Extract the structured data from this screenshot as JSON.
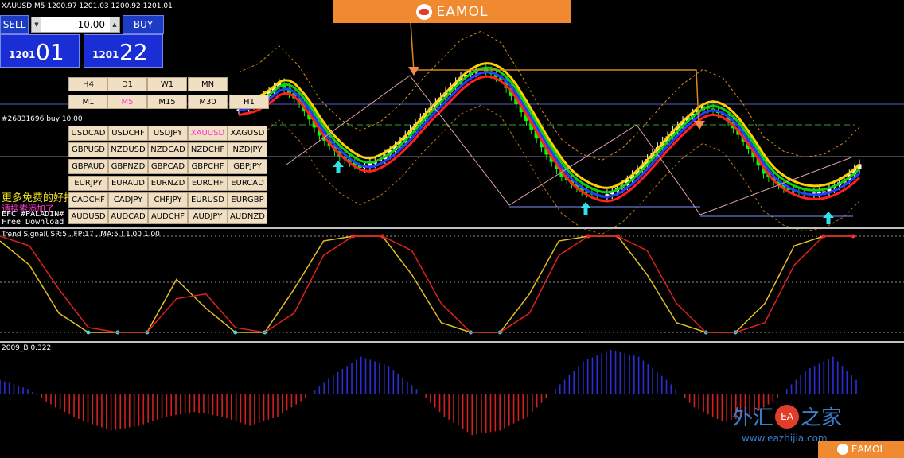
{
  "window": {
    "symbol_header": "XAUUSD,M5  1200.97 1201.03 1200.92 1201.01",
    "order_label": "#26831696 buy 10.00",
    "sub1_header": "Trend Signal( SR:5 , FP:17 , MA:5 ) 1.00 1.00",
    "sub2_header": "2009_B 0.322",
    "promo_line1": "更多免费的好指",
    "promo_line2": "请搜索添加了",
    "promo_line3": "EFC #PALADIN#",
    "promo_line4": "Free Download For"
  },
  "banner": {
    "brand": "EAMOL"
  },
  "trade_panel": {
    "sell_label": "SELL",
    "buy_label": "BUY",
    "lot_value": "10.00",
    "bid_prefix": "1201",
    "bid_big": "01",
    "ask_prefix": "1201",
    "ask_big": "22"
  },
  "timeframes": [
    {
      "label": "H4",
      "active": false
    },
    {
      "label": "D1",
      "active": false
    },
    {
      "label": "W1",
      "active": false
    },
    {
      "label": "MN",
      "active": false
    },
    {
      "label": "M1",
      "active": false
    },
    {
      "label": "M5",
      "active": true
    },
    {
      "label": "M15",
      "active": false
    },
    {
      "label": "M30",
      "active": false
    },
    {
      "label": "H1",
      "active": false
    }
  ],
  "pairs": [
    {
      "label": "USDCAD",
      "active": false
    },
    {
      "label": "USDCHF",
      "active": false
    },
    {
      "label": "USDJPY",
      "active": false
    },
    {
      "label": "XAUUSD",
      "active": true
    },
    {
      "label": "XAGUSD",
      "active": false
    },
    {
      "label": "GBPUSD",
      "active": false
    },
    {
      "label": "NZDUSD",
      "active": false
    },
    {
      "label": "NZDCAD",
      "active": false
    },
    {
      "label": "NZDCHF",
      "active": false
    },
    {
      "label": "NZDJPY",
      "active": false
    },
    {
      "label": "GBPAUD",
      "active": false
    },
    {
      "label": "GBPNZD",
      "active": false
    },
    {
      "label": "GBPCAD",
      "active": false
    },
    {
      "label": "GBPCHF",
      "active": false
    },
    {
      "label": "GBPJPY",
      "active": false
    },
    {
      "label": "EURJPY",
      "active": false
    },
    {
      "label": "EURAUD",
      "active": false
    },
    {
      "label": "EURNZD",
      "active": false
    },
    {
      "label": "EURCHF",
      "active": false
    },
    {
      "label": "EURCAD",
      "active": false
    },
    {
      "label": "CADCHF",
      "active": false
    },
    {
      "label": "CADJPY",
      "active": false
    },
    {
      "label": "CHFJPY",
      "active": false
    },
    {
      "label": "EURUSD",
      "active": false
    },
    {
      "label": "EURGBP",
      "active": false
    },
    {
      "label": "AUDUSD",
      "active": false
    },
    {
      "label": "AUDCAD",
      "active": false
    },
    {
      "label": "AUDCHF",
      "active": false
    },
    {
      "label": "AUDJPY",
      "active": false
    },
    {
      "label": "AUDNZD",
      "active": false
    }
  ],
  "watermark": {
    "cn_text_a": "外汇",
    "seal": "EA",
    "cn_text_b": "之家",
    "url": "www.eazhijia.com",
    "footer_brand": "EAMOL"
  },
  "colors": {
    "background": "#000000",
    "bull_candle": "#ffffff",
    "bear_candle": "#00ff00",
    "ma_red": "#ff2020",
    "ma_blue": "#2040ff",
    "ma_yellow": "#ffd000",
    "channel": "#d98a1e",
    "histo_pos": "#2b2fd6",
    "histo_neg": "#d02020",
    "panel_blue": "#1d3cc6",
    "arrow_cyan": "#33e0e8"
  },
  "icons": {
    "up_arrow": "up-arrow-icon",
    "signal_arrow": "down-arrow-icon",
    "banner_logo": "eamol-logo-icon"
  },
  "chart_data": [
    {
      "type": "line",
      "title": "XAUUSD,M5",
      "series": [
        {
          "name": "",
          "values": [
            1201.2,
            1201.5,
            1202.1,
            1201.4,
            1200.3,
            1199.6,
            1199.2,
            1199.5,
            1200.1,
            1200.9,
            1201.6,
            1202.3,
            1202.6,
            1202.2,
            1201.1,
            1199.9,
            1198.9,
            1198.4,
            1198.2,
            1198.6,
            1199.3,
            1200.1,
            1200.8,
            1201.3,
            1201.0,
            1200.1,
            1199.0,
            1198.5,
            1198.3,
            1198.4,
            1198.8,
            1199.5
          ]
        }
      ]
    },
    {
      "type": "line",
      "title": "Trend Signal( SR:5 , FP:17 , MA:5 ) 1.00 1.00",
      "series": [
        {
          "name": "",
          "values": [
            0.95,
            0.7,
            0.2,
            0.0,
            0.0,
            0.0,
            0.55,
            0.25,
            0.0,
            0.0,
            0.45,
            0.95,
            1.0,
            1.0,
            0.6,
            0.1,
            0.0,
            0.0,
            0.4,
            0.95,
            1.0,
            1.0,
            0.6,
            0.1,
            0.0,
            0.0,
            0.3,
            0.9,
            1.0,
            1.0
          ]
        },
        {
          "name": "",
          "values": [
            1.0,
            0.9,
            0.45,
            0.05,
            0.0,
            0.0,
            0.35,
            0.4,
            0.05,
            0.0,
            0.2,
            0.8,
            1.0,
            1.0,
            0.85,
            0.3,
            0.0,
            0.0,
            0.2,
            0.8,
            1.0,
            1.0,
            0.85,
            0.3,
            0.0,
            0.0,
            0.1,
            0.7,
            1.0,
            1.0
          ]
        }
      ]
    },
    {
      "type": "bar",
      "title": "2009_B 0.322",
      "values": [
        0.3,
        0.1,
        -0.3,
        -0.6,
        -0.8,
        -0.7,
        -0.5,
        -0.4,
        -0.5,
        -0.7,
        -0.5,
        -0.1,
        0.4,
        0.8,
        0.6,
        0.1,
        -0.5,
        -0.9,
        -0.8,
        -0.5,
        0.1,
        0.7,
        0.95,
        0.8,
        0.3,
        -0.3,
        -0.6,
        -0.5,
        -0.1,
        0.5,
        0.8,
        0.2
      ]
    }
  ]
}
